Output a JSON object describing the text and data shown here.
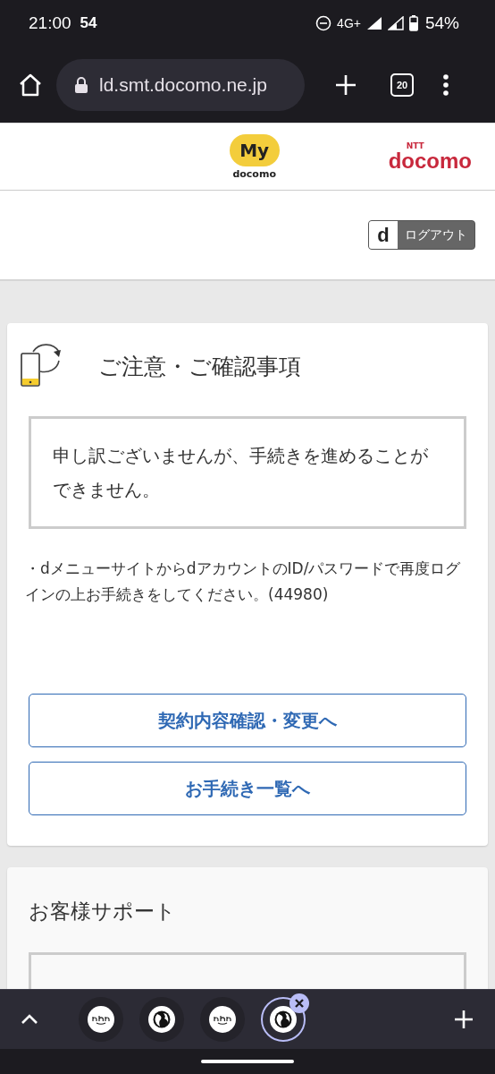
{
  "status_bar": {
    "time": "21:00",
    "extra": "54",
    "network": "4G+",
    "battery": "54%"
  },
  "toolbar": {
    "url": "ld.smt.docomo.ne.jp",
    "tab_count": "20"
  },
  "header": {
    "my_logo": "My",
    "my_logo_sub": "docomo",
    "brand_small": "NTT",
    "brand": "docomo"
  },
  "logout": {
    "mark": "d",
    "label": "ログアウト"
  },
  "notice_card": {
    "title": "ご注意・ご確認事項",
    "message": "申し訳ございませんが、手続きを進めることができません。",
    "detail": "・dメニューサイトからdアカウントのID/パスワードで再度ログインの上お手続きをしてください。(44980)",
    "buttons": [
      "契約内容確認・変更へ",
      "お手続き一覧へ"
    ]
  },
  "support_card": {
    "title": "お客様サポート"
  },
  "tab_strip": {
    "tabs": [
      {
        "kind": "aha",
        "selected": false
      },
      {
        "kind": "globe",
        "selected": false
      },
      {
        "kind": "aha",
        "selected": false
      },
      {
        "kind": "globe",
        "selected": true
      }
    ]
  }
}
